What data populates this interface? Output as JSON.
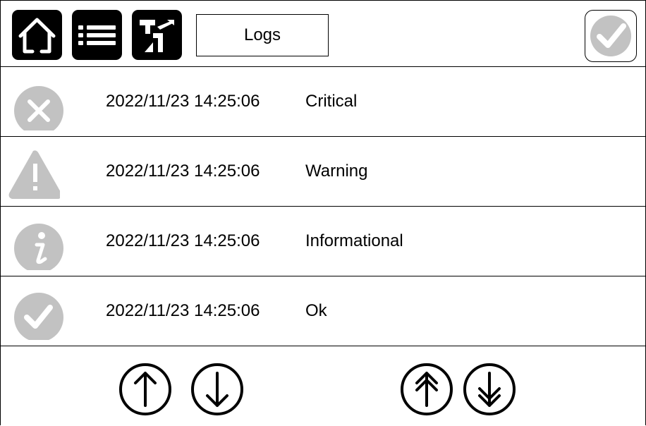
{
  "header": {
    "home_icon": "home-icon",
    "menu_icon": "menu-list-icon",
    "tools_icon": "tools-icon",
    "title": "Logs",
    "confirm_icon": "checkmark-icon"
  },
  "logs": [
    {
      "icon": "critical-x-icon",
      "timestamp": "2022/11/23 14:25:06",
      "level": "Critical"
    },
    {
      "icon": "warning-triangle-icon",
      "timestamp": "2022/11/23 14:25:06",
      "level": "Warning"
    },
    {
      "icon": "info-icon",
      "timestamp": "2022/11/23 14:25:06",
      "level": "Informational"
    },
    {
      "icon": "ok-check-icon",
      "timestamp": "2022/11/23 14:25:06",
      "level": "Ok"
    }
  ],
  "navigation": {
    "scroll_up_icon": "arrow-up-icon",
    "scroll_down_icon": "arrow-down-icon",
    "page_up_icon": "double-arrow-up-icon",
    "page_down_icon": "double-arrow-down-icon"
  },
  "colors": {
    "icon_gray": "#c2c2c2",
    "button_black": "#000000"
  }
}
